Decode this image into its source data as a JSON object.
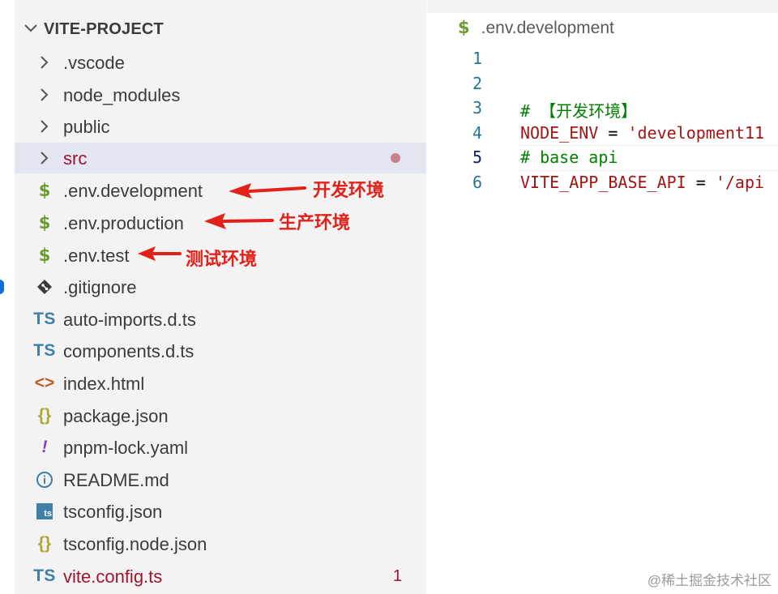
{
  "explorer": {
    "project_title": "VITE-PROJECT",
    "items": [
      {
        "label": ".vscode",
        "type": "folder"
      },
      {
        "label": "node_modules",
        "type": "folder"
      },
      {
        "label": "public",
        "type": "folder"
      },
      {
        "label": "src",
        "type": "folder"
      },
      {
        "label": ".env.development",
        "type": "env",
        "icon": "$"
      },
      {
        "label": ".env.production",
        "type": "env",
        "icon": "$"
      },
      {
        "label": ".env.test",
        "type": "env",
        "icon": "$"
      },
      {
        "label": ".gitignore",
        "type": "git"
      },
      {
        "label": "auto-imports.d.ts",
        "type": "ts",
        "icon": "TS"
      },
      {
        "label": "components.d.ts",
        "type": "ts",
        "icon": "TS"
      },
      {
        "label": "index.html",
        "type": "html",
        "icon": "<>"
      },
      {
        "label": "package.json",
        "type": "json",
        "icon": "{}"
      },
      {
        "label": "pnpm-lock.yaml",
        "type": "yaml",
        "icon": "!"
      },
      {
        "label": "README.md",
        "type": "info"
      },
      {
        "label": "tsconfig.json",
        "type": "tsconfig",
        "icon": "ts"
      },
      {
        "label": "tsconfig.node.json",
        "type": "json",
        "icon": "{}"
      },
      {
        "label": "vite.config.ts",
        "type": "ts",
        "icon": "TS",
        "badge": "1"
      }
    ]
  },
  "annotations": {
    "dev": "开发环境",
    "prod": "生产环境",
    "test": "测试环境"
  },
  "editor": {
    "tab_icon": "$",
    "tab_title": ".env.development",
    "lines": [
      {
        "num": "1",
        "code": ""
      },
      {
        "num": "2",
        "code": ""
      },
      {
        "num": "3",
        "comment": "# 【开发环境】"
      },
      {
        "num": "4",
        "key": "NODE_ENV",
        "op": " = ",
        "str": "'development11"
      },
      {
        "num": "5",
        "comment": "# base api"
      },
      {
        "num": "6",
        "key": "VITE_APP_BASE_API",
        "op": " = ",
        "str": "'/api"
      }
    ]
  },
  "watermark": "@稀土掘金技术社区",
  "colors": {
    "accent_red": "#e1211a",
    "modified": "#a0132f",
    "selected_row": "#e4e6f1"
  }
}
